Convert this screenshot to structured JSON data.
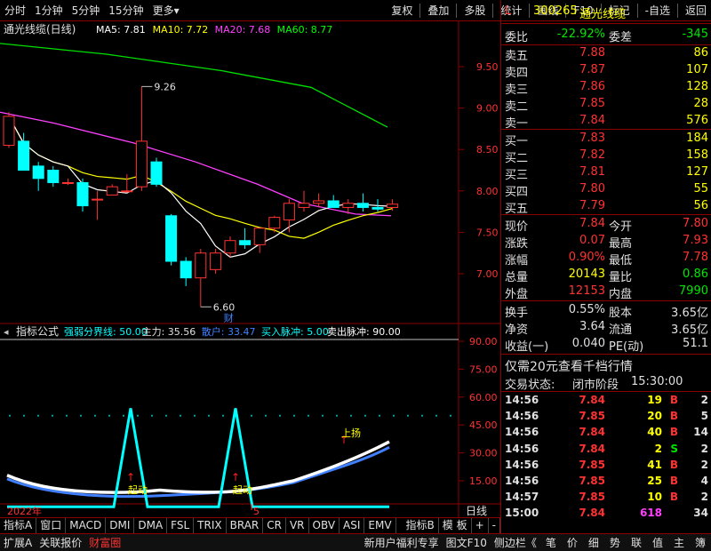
{
  "toolbar": {
    "left": [
      "分时",
      "1分钟",
      "5分钟",
      "15分钟",
      "更多▾"
    ],
    "right": [
      "复权",
      "叠加",
      "多股",
      "统计",
      "画线",
      "F10",
      "标记",
      "-自选",
      "返回"
    ]
  },
  "chart": {
    "title": "通光线缆(日线)",
    "ma": [
      {
        "label": "MA5: 7.81",
        "color": "#ffffff"
      },
      {
        "label": "MA10: 7.72",
        "color": "#ffff00"
      },
      {
        "label": "MA20: 7.68",
        "color": "#ff40ff"
      },
      {
        "label": "MA60: 8.77",
        "color": "#00ff00"
      }
    ],
    "price_ticks": [
      "9.50",
      "9.00",
      "8.50",
      "8.00",
      "7.50",
      "7.00"
    ],
    "high_label": "9.26",
    "low_label": "6.60",
    "cai_label": "财",
    "candles": [
      {
        "o": 8.55,
        "h": 8.95,
        "l": 8.52,
        "c": 8.9
      },
      {
        "o": 8.6,
        "h": 8.7,
        "l": 8.35,
        "c": 8.25
      },
      {
        "o": 8.3,
        "h": 8.35,
        "l": 8.0,
        "c": 8.15
      },
      {
        "o": 8.25,
        "h": 8.3,
        "l": 8.05,
        "c": 8.1
      },
      {
        "o": 8.1,
        "h": 8.15,
        "l": 8.07,
        "c": 8.1
      },
      {
        "o": 8.1,
        "h": 8.15,
        "l": 7.75,
        "c": 7.82
      },
      {
        "o": 7.9,
        "h": 8.0,
        "l": 7.65,
        "c": 7.9
      },
      {
        "o": 7.95,
        "h": 8.08,
        "l": 7.95,
        "c": 8.05
      },
      {
        "o": 8.0,
        "h": 8.2,
        "l": 7.98,
        "c": 8.0
      },
      {
        "o": 8.05,
        "h": 9.26,
        "l": 8.0,
        "c": 8.6
      },
      {
        "o": 8.35,
        "h": 8.4,
        "l": 8.05,
        "c": 8.08
      },
      {
        "o": 7.7,
        "h": 7.72,
        "l": 7.1,
        "c": 7.15
      },
      {
        "o": 7.15,
        "h": 7.2,
        "l": 6.85,
        "c": 6.95
      },
      {
        "o": 6.95,
        "h": 7.3,
        "l": 6.6,
        "c": 7.25
      },
      {
        "o": 7.05,
        "h": 7.3,
        "l": 7.0,
        "c": 7.25
      },
      {
        "o": 7.25,
        "h": 7.45,
        "l": 7.2,
        "c": 7.4
      },
      {
        "o": 7.4,
        "h": 7.55,
        "l": 7.3,
        "c": 7.35
      },
      {
        "o": 7.35,
        "h": 7.55,
        "l": 7.25,
        "c": 7.55
      },
      {
        "o": 7.55,
        "h": 7.7,
        "l": 7.5,
        "c": 7.68
      },
      {
        "o": 7.65,
        "h": 7.9,
        "l": 7.5,
        "c": 7.85
      },
      {
        "o": 7.8,
        "h": 8.0,
        "l": 7.75,
        "c": 7.85
      },
      {
        "o": 7.85,
        "h": 7.97,
        "l": 7.8,
        "c": 7.88
      },
      {
        "o": 7.88,
        "h": 7.95,
        "l": 7.8,
        "c": 7.8
      },
      {
        "o": 7.8,
        "h": 7.9,
        "l": 7.72,
        "c": 7.85
      },
      {
        "o": 7.85,
        "h": 7.97,
        "l": 7.75,
        "c": 7.8
      },
      {
        "o": 7.8,
        "h": 7.9,
        "l": 7.75,
        "c": 7.78
      },
      {
        "o": 7.8,
        "h": 7.9,
        "l": 7.76,
        "c": 7.84
      }
    ]
  },
  "indicator": {
    "name": "指标公式",
    "params": [
      {
        "label": "强弱分界线: 50.00",
        "color": "#00ffff"
      },
      {
        "label": "主力: 35.56",
        "color": "#e0e0e0"
      },
      {
        "label": "散户: 33.47",
        "color": "#4080ff"
      },
      {
        "label": "买入脉冲: 5.00",
        "color": "#00ffff"
      },
      {
        "label": "卖出脉冲: 90.00",
        "color": "#ffffff"
      }
    ],
    "ticks": [
      "90.00",
      "75.00",
      "60.00",
      "45.00",
      "30.00",
      "15.00"
    ],
    "labels": [
      "起动",
      "起动",
      "上扬"
    ]
  },
  "xaxis": {
    "year": "2022年",
    "month": "5",
    "period": "日线"
  },
  "tabs": [
    "指标A",
    "窗口",
    "MACD",
    "DMI",
    "DMA",
    "FSL",
    "TRIX",
    "BRAR",
    "CR",
    "VR",
    "OBV",
    "ASI",
    "EMV",
    "指标B",
    "模 板",
    "+",
    "-"
  ],
  "bottom": {
    "left": [
      "扩展A",
      "关联报价",
      "财富圈"
    ],
    "right": [
      "新用户福利专享",
      "图文F10",
      "侧边栏《"
    ],
    "icons": [
      "笔",
      "价",
      "细",
      "势",
      "联",
      "值",
      "主",
      "簿"
    ]
  },
  "quote": {
    "flag": "L",
    "code": "300265",
    "name": "通光线缆",
    "webi_label": "委比",
    "webi": "-22.92%",
    "weicha_label": "委差",
    "weicha": "-345",
    "sells": [
      {
        "label": "卖五",
        "price": "7.88",
        "vol": "86"
      },
      {
        "label": "卖四",
        "price": "7.87",
        "vol": "107"
      },
      {
        "label": "卖三",
        "price": "7.86",
        "vol": "128"
      },
      {
        "label": "卖二",
        "price": "7.85",
        "vol": "28"
      },
      {
        "label": "卖一",
        "price": "7.84",
        "vol": "576"
      }
    ],
    "buys": [
      {
        "label": "买一",
        "price": "7.83",
        "vol": "184"
      },
      {
        "label": "买二",
        "price": "7.82",
        "vol": "158"
      },
      {
        "label": "买三",
        "price": "7.81",
        "vol": "127"
      },
      {
        "label": "买四",
        "price": "7.80",
        "vol": "55"
      },
      {
        "label": "买五",
        "price": "7.79",
        "vol": "56"
      }
    ],
    "stats": [
      [
        {
          "l": "现价",
          "v": "7.84",
          "c": "red"
        },
        {
          "l": "今开",
          "v": "7.80",
          "c": "red"
        }
      ],
      [
        {
          "l": "涨跌",
          "v": "0.07",
          "c": "red"
        },
        {
          "l": "最高",
          "v": "7.93",
          "c": "red"
        }
      ],
      [
        {
          "l": "涨幅",
          "v": "0.90%",
          "c": "red"
        },
        {
          "l": "最低",
          "v": "7.78",
          "c": "red"
        }
      ],
      [
        {
          "l": "总量",
          "v": "20143",
          "c": "yellow"
        },
        {
          "l": "量比",
          "v": "0.86",
          "c": "green"
        }
      ],
      [
        {
          "l": "外盘",
          "v": "12153",
          "c": "red"
        },
        {
          "l": "内盘",
          "v": "7990",
          "c": "green"
        }
      ]
    ],
    "stats2": [
      [
        {
          "l": "换手",
          "v": "0.55%",
          "c": "white"
        },
        {
          "l": "股本",
          "v": "3.65亿",
          "c": "white"
        }
      ],
      [
        {
          "l": "净资",
          "v": "3.64",
          "c": "white"
        },
        {
          "l": "流通",
          "v": "3.65亿",
          "c": "white"
        }
      ],
      [
        {
          "l": "收益(一)",
          "v": "0.040",
          "c": "white"
        },
        {
          "l": "PE(动)",
          "v": "51.1",
          "c": "white"
        }
      ]
    ],
    "promo": "仅需20元查看千档行情",
    "status_label": "交易状态:",
    "status": "闭市阶段",
    "status_time": "15:30:00",
    "ticks": [
      {
        "t": "14:56",
        "p": "7.84",
        "v": "19",
        "bs": "B",
        "n": "2"
      },
      {
        "t": "14:56",
        "p": "7.85",
        "v": "20",
        "bs": "B",
        "n": "5"
      },
      {
        "t": "14:56",
        "p": "7.84",
        "v": "40",
        "bs": "B",
        "n": "14"
      },
      {
        "t": "14:56",
        "p": "7.84",
        "v": "2",
        "bs": "S",
        "n": "2"
      },
      {
        "t": "14:56",
        "p": "7.85",
        "v": "41",
        "bs": "B",
        "n": "2"
      },
      {
        "t": "14:56",
        "p": "7.85",
        "v": "25",
        "bs": "B",
        "n": "4"
      },
      {
        "t": "14:57",
        "p": "7.85",
        "v": "10",
        "bs": "B",
        "n": "2"
      },
      {
        "t": "15:00",
        "p": "7.84",
        "v": "618",
        "bs": "",
        "n": "34"
      }
    ]
  }
}
